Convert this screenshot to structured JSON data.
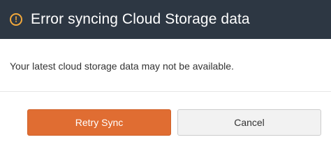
{
  "dialog": {
    "title": "Error syncing Cloud Storage data",
    "icon": "warning-icon",
    "message": "Your latest cloud storage data may not be available.",
    "buttons": {
      "retry_label": "Retry Sync",
      "cancel_label": "Cancel"
    },
    "colors": {
      "header_bg": "#2d3743",
      "icon": "#f3a93b",
      "primary_button": "#e06d32",
      "secondary_button": "#f2f2f2"
    }
  }
}
